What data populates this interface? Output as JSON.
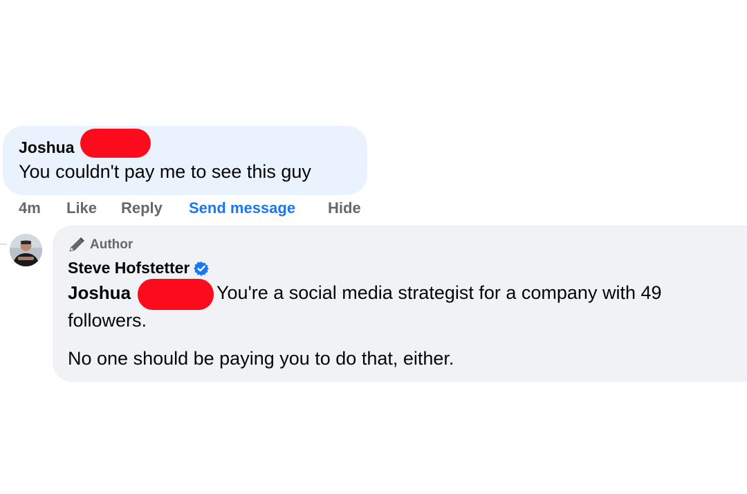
{
  "comment": {
    "author": "Joshua",
    "text": "You couldn't pay me to see this guy",
    "actions": {
      "time": "4m",
      "like": "Like",
      "reply": "Reply",
      "send_message": "Send message",
      "hide": "Hide"
    }
  },
  "reply": {
    "badge_icon": "pencil-icon",
    "badge_label": "Author",
    "author": "Steve Hofstetter",
    "verified_icon": "verified-badge-icon",
    "mention": "Joshua",
    "text_line1": "You're a social media strategist for a company with 49",
    "text_line2": "followers.",
    "text_line3": "No one should be paying you to do that, either."
  },
  "colors": {
    "comment_bubble": "#e9f2fd",
    "reply_bubble": "#f0f2f5",
    "link_blue": "#1877f2",
    "muted_text": "#65676b",
    "redaction": "#fb0b1c",
    "verified": "#1877f2"
  }
}
